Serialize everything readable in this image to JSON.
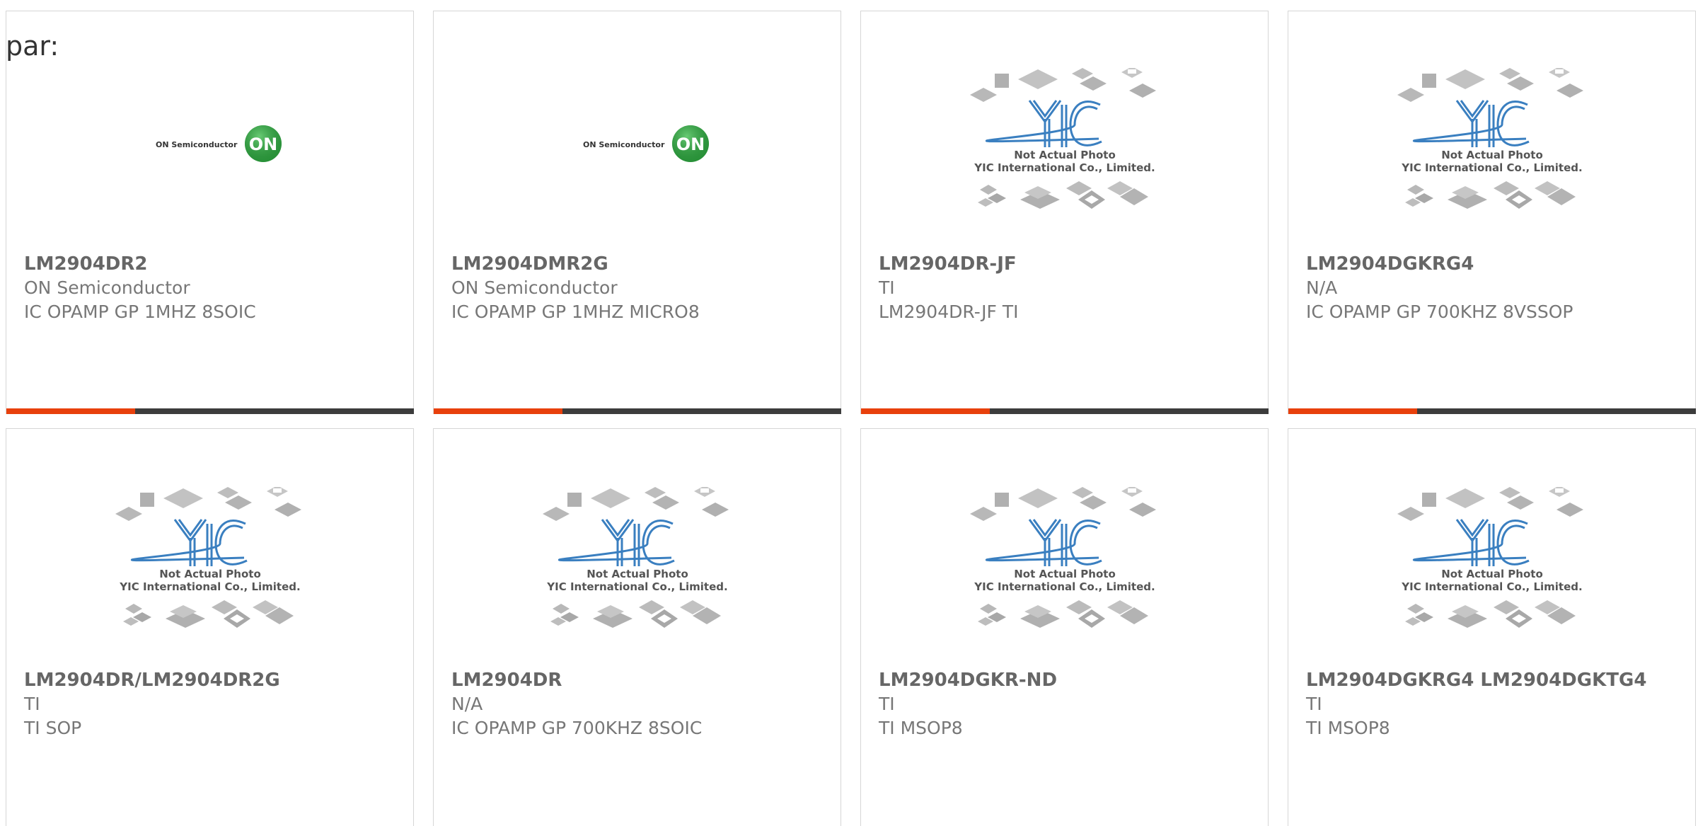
{
  "heading": "par:",
  "accent_color": "#e8400c",
  "bar_color": "#3c3c3c",
  "products": [
    {
      "part_number": "LM2904DR2",
      "manufacturer": "ON Semiconductor",
      "description": "IC OPAMP GP 1MHZ 8SOIC",
      "image": {
        "type": "on-logo",
        "brand_text": "ON Semiconductor",
        "badge_text": "ON"
      }
    },
    {
      "part_number": "LM2904DMR2G",
      "manufacturer": "ON Semiconductor",
      "description": "IC OPAMP GP 1MHZ MICRO8",
      "image": {
        "type": "on-logo",
        "brand_text": "ON Semiconductor",
        "badge_text": "ON"
      }
    },
    {
      "part_number": "LM2904DR-JF",
      "manufacturer": "TI",
      "description": "LM2904DR-JF TI",
      "image": {
        "type": "yic-placeholder",
        "line1": "Not Actual Photo",
        "line2": "YIC International Co., Limited."
      }
    },
    {
      "part_number": "LM2904DGKRG4",
      "manufacturer": "N/A",
      "description": "IC OPAMP GP 700KHZ 8VSSOP",
      "image": {
        "type": "yic-placeholder",
        "line1": "Not Actual Photo",
        "line2": "YIC International Co., Limited."
      }
    },
    {
      "part_number": "LM2904DR/LM2904DR2G",
      "manufacturer": "TI",
      "description": "TI SOP",
      "image": {
        "type": "yic-placeholder",
        "line1": "Not Actual Photo",
        "line2": "YIC International Co., Limited."
      }
    },
    {
      "part_number": "LM2904DR",
      "manufacturer": "N/A",
      "description": "IC OPAMP GP 700KHZ 8SOIC",
      "image": {
        "type": "yic-placeholder",
        "line1": "Not Actual Photo",
        "line2": "YIC International Co., Limited."
      }
    },
    {
      "part_number": "LM2904DGKR-ND",
      "manufacturer": "TI",
      "description": "TI MSOP8",
      "image": {
        "type": "yic-placeholder",
        "line1": "Not Actual Photo",
        "line2": "YIC International Co., Limited."
      }
    },
    {
      "part_number": "LM2904DGKRG4 LM2904DGKTG4",
      "manufacturer": "TI",
      "description": "TI MSOP8",
      "image": {
        "type": "yic-placeholder",
        "line1": "Not Actual Photo",
        "line2": "YIC International Co., Limited."
      }
    }
  ]
}
